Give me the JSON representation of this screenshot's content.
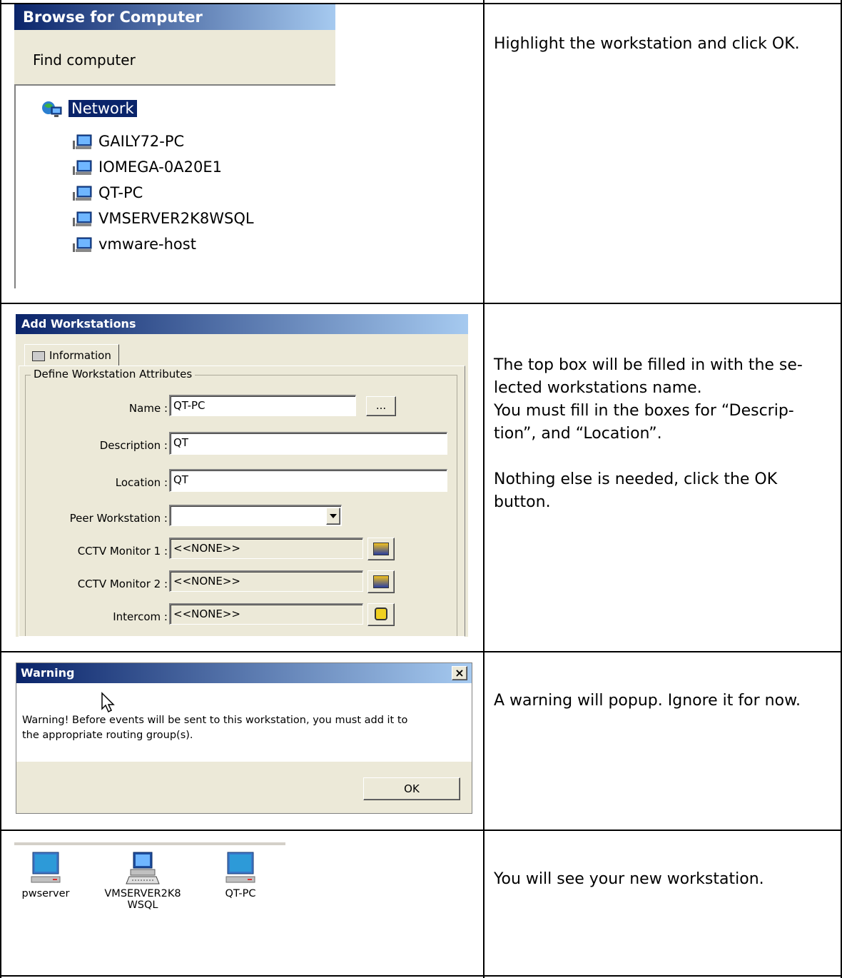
{
  "rows": [
    {
      "instruction": [
        "Highlight the workstation and click OK."
      ]
    },
    {
      "instruction": [
        "The top box will be filled in with the se-",
        "lected workstations name.",
        "You must fill in the boxes for “Descrip-",
        "tion”, and “Location”.",
        "",
        "Nothing else is needed, click the OK",
        "button."
      ]
    },
    {
      "instruction": [
        "A warning will popup. Ignore it for now."
      ]
    },
    {
      "instruction": [
        "You will see your new workstation."
      ]
    }
  ],
  "browse_dialog": {
    "title": "Browse for Computer",
    "prompt": "Find computer",
    "root": "Network",
    "computers": [
      "GAILY72-PC",
      "IOMEGA-0A20E1",
      "QT-PC",
      "VMSERVER2K8WSQL",
      "vmware-host"
    ]
  },
  "add_workstation": {
    "title": "Add Workstations",
    "tab": "Information",
    "group": "Define Workstation Attributes",
    "fields": {
      "name_label": "Name :",
      "name_value": "QT-PC",
      "browse_button": "...",
      "description_label": "Description :",
      "description_value": "QT",
      "location_label": "Location :",
      "location_value": "QT",
      "peer_label": "Peer Workstation :",
      "peer_value": "",
      "cctv1_label": "CCTV Monitor 1 :",
      "cctv1_value": "<<NONE>>",
      "cctv2_label": "CCTV Monitor 2 :",
      "cctv2_value": "<<NONE>>",
      "intercom_label": "Intercom :",
      "intercom_value": "<<NONE>>"
    }
  },
  "warning_dialog": {
    "title": "Warning",
    "close": "×",
    "message_line1": "Warning! Before events will be sent to this workstation, you must add it to",
    "message_line2": "the appropriate routing group(s).",
    "ok": "OK"
  },
  "desktop_icons": [
    {
      "label": "pwserver",
      "label2": ""
    },
    {
      "label": "VMSERVER2K8",
      "label2": "WSQL"
    },
    {
      "label": "QT-PC",
      "label2": ""
    }
  ]
}
